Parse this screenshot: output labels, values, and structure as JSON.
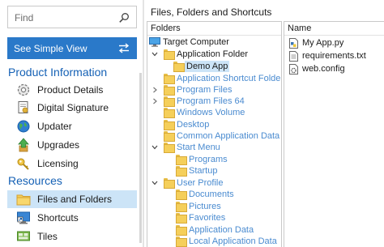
{
  "search": {
    "placeholder": "Find"
  },
  "simple_view": {
    "label": "See Simple View"
  },
  "sections": {
    "product_information": "Product Information",
    "resources": "Resources"
  },
  "nav": {
    "product_details": "Product Details",
    "digital_signature": "Digital Signature",
    "updater": "Updater",
    "upgrades": "Upgrades",
    "licensing": "Licensing",
    "files_and_folders": "Files and Folders",
    "shortcuts": "Shortcuts",
    "tiles": "Tiles"
  },
  "pane": {
    "title": "Files, Folders and Shortcuts"
  },
  "folders": {
    "header": "Folders",
    "target_computer": "Target Computer",
    "application_folder": "Application Folder",
    "demo_app": "Demo App",
    "application_shortcut_folder": "Application Shortcut Folder",
    "program_files": "Program Files",
    "program_files_64": "Program Files 64",
    "windows_volume": "Windows Volume",
    "desktop": "Desktop",
    "common_application_data": "Common Application Data",
    "start_menu": "Start Menu",
    "programs": "Programs",
    "startup": "Startup",
    "user_profile": "User Profile",
    "documents": "Documents",
    "pictures": "Pictures",
    "favorites": "Favorites",
    "application_data": "Application Data",
    "local_application_data": "Local Application Data"
  },
  "files": {
    "header": "Name",
    "items": [
      "My App.py",
      "requirements.txt",
      "web.config"
    ]
  }
}
